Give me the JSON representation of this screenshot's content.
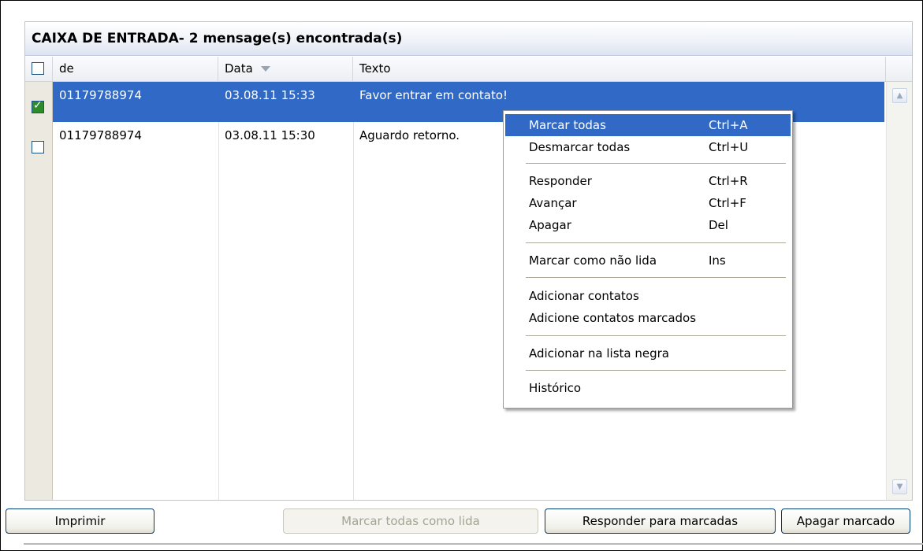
{
  "title": "CAIXA DE ENTRADA- 2 mensage(s) encontrada(s)",
  "columns": {
    "from": "de",
    "date": "Data",
    "text": "Texto"
  },
  "messages": [
    {
      "from": "01179788974",
      "date": "03.08.11 15:33",
      "text": "Favor entrar em contato!",
      "checked": true,
      "selected": true
    },
    {
      "from": "01179788974",
      "date": "03.08.11 15:30",
      "text": "Aguardo retorno.",
      "checked": false,
      "selected": false
    }
  ],
  "context_menu": {
    "items": [
      {
        "label": "Marcar todas",
        "shortcut": "Ctrl+A",
        "highlighted": true
      },
      {
        "label": "Desmarcar todas",
        "shortcut": "Ctrl+U"
      },
      {
        "label": "Responder",
        "shortcut": "Ctrl+R"
      },
      {
        "label": "Avançar",
        "shortcut": "Ctrl+F"
      },
      {
        "label": "Apagar",
        "shortcut": "Del"
      },
      {
        "label": "Marcar como não lida",
        "shortcut": "Ins"
      },
      {
        "label": "Adicionar contatos",
        "shortcut": ""
      },
      {
        "label": "Adicione contatos marcados",
        "shortcut": ""
      },
      {
        "label": "Adicionar na lista negra",
        "shortcut": ""
      },
      {
        "label": "Histórico",
        "shortcut": ""
      }
    ]
  },
  "buttons": {
    "print": "Imprimir",
    "mark_all_read": "Marcar todas como lida",
    "reply_marked": "Responder para marcadas",
    "delete_marked": "Apagar marcado"
  },
  "colors": {
    "selection": "#3169c6",
    "panel_border": "#b9c7dc"
  },
  "icons": {
    "sort": "sort-down-icon",
    "scroll_up": "scroll-up-icon",
    "scroll_down": "scroll-down-icon",
    "checkbox": "checkbox-icon"
  }
}
